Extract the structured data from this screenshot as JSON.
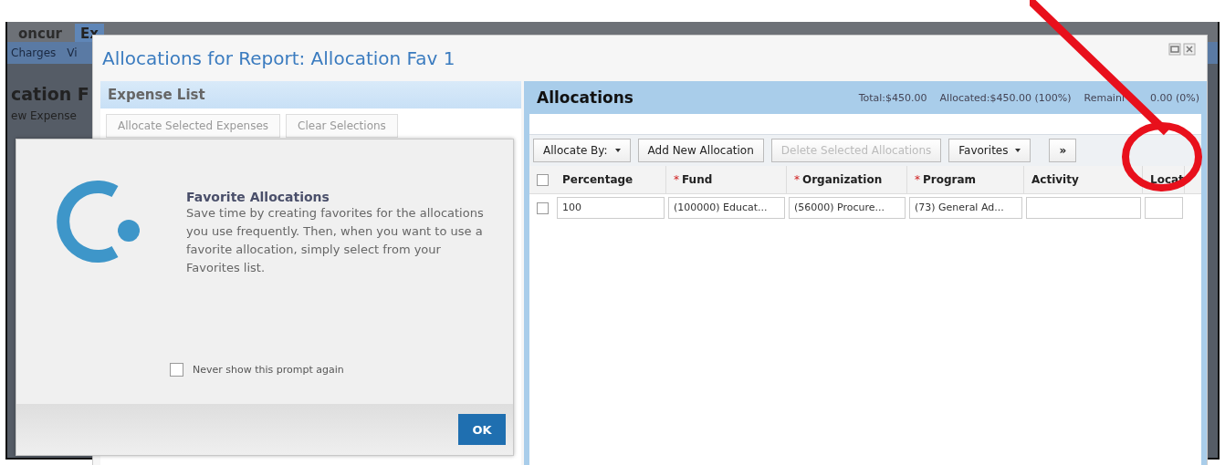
{
  "background_app": {
    "menu": [
      {
        "label": "oncur",
        "selected": false
      },
      {
        "label": "Ex",
        "selected": true
      }
    ],
    "submenu": [
      "Charges",
      "Vi"
    ],
    "page_title": "cation F",
    "side_link": "ew Expense"
  },
  "dialog": {
    "title": "Allocations for Report: Allocation Fav 1",
    "expense_list": {
      "title": "Expense List",
      "buttons": [
        "Allocate Selected Expenses",
        "Clear Selections"
      ]
    },
    "allocations": {
      "title": "Allocations",
      "totals": [
        "Total:$450.00",
        "Allocated:$450.00 (100%)",
        "Remaini",
        "0.00 (0%)"
      ],
      "all_checked": false,
      "toolbar": [
        {
          "label": "Allocate By:",
          "kind": "dropdown",
          "disabled": false
        },
        {
          "label": "Add New Allocation",
          "kind": "button",
          "disabled": false
        },
        {
          "label": "Delete Selected Allocations",
          "kind": "button",
          "disabled": true
        },
        {
          "label": "Favorites",
          "kind": "dropdown",
          "disabled": false
        },
        {
          "label": "»",
          "kind": "button",
          "disabled": false
        }
      ],
      "columns": [
        {
          "label": "Percentage"
        },
        {
          "label": "Fund",
          "required_mark": "*"
        },
        {
          "label": "Organization",
          "required_mark": "*"
        },
        {
          "label": "Program",
          "required_mark": "*"
        },
        {
          "label": "Activity"
        },
        {
          "label": "Locat"
        }
      ],
      "rows": [
        {
          "checked": false,
          "cells": [
            "100",
            "(100000) Educat...",
            "(56000) Procure...",
            "(73) General Ad...",
            "",
            ""
          ]
        }
      ]
    }
  },
  "prompt": {
    "title": "Favorite Allocations",
    "body": "Save time by creating favorites for the allocations you use frequently. Then, when you want to use a favorite allocation, simply select from your Favorites list.",
    "never_show": {
      "label": "Never show this prompt again",
      "checked": false
    },
    "ok": "OK"
  }
}
